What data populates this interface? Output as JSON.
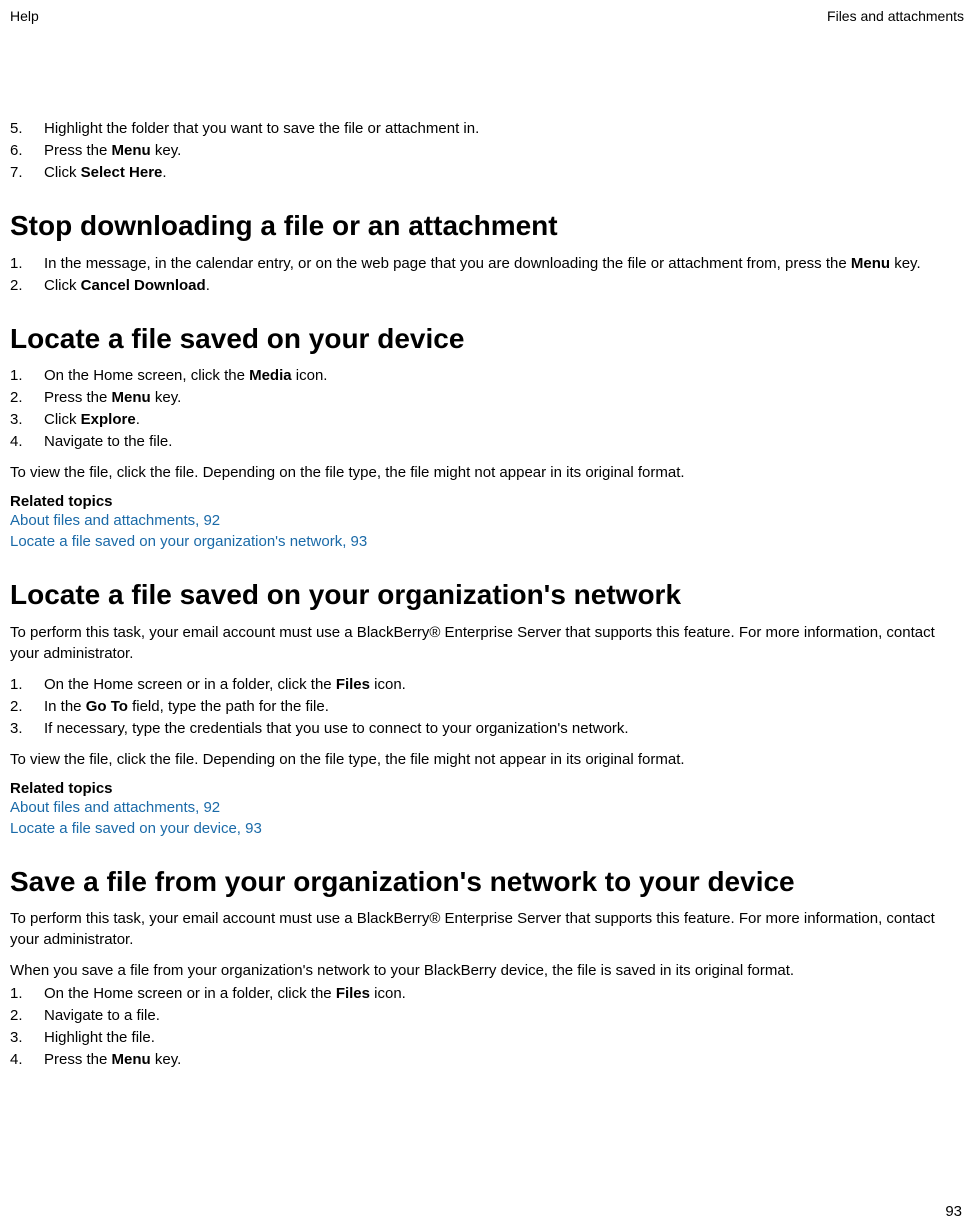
{
  "header": {
    "left": "Help",
    "right": "Files and attachments"
  },
  "list1": {
    "items": [
      {
        "num": "5.",
        "text": "Highlight the folder that you want to save the file or attachment in."
      },
      {
        "num": "6.",
        "prefix": "Press the ",
        "bold": "Menu",
        "suffix": " key."
      },
      {
        "num": "7.",
        "prefix": "Click ",
        "bold": "Select Here",
        "suffix": "."
      }
    ]
  },
  "h2_1": "Stop downloading a file or an attachment",
  "list2": {
    "items": [
      {
        "num": "1.",
        "prefix": "In the message, in the calendar entry, or on the web page that you are downloading the file or attachment from, press the ",
        "bold": "Menu",
        "suffix": " key."
      },
      {
        "num": "2.",
        "prefix": "Click ",
        "bold": "Cancel Download",
        "suffix": "."
      }
    ]
  },
  "h2_2": "Locate a file saved on your device",
  "list3": {
    "items": [
      {
        "num": "1.",
        "prefix": "On the Home screen, click the ",
        "bold": "Media",
        "suffix": " icon."
      },
      {
        "num": "2.",
        "prefix": "Press the ",
        "bold": "Menu",
        "suffix": " key."
      },
      {
        "num": "3.",
        "prefix": "Click ",
        "bold": "Explore",
        "suffix": "."
      },
      {
        "num": "4.",
        "text": "Navigate to the file."
      }
    ]
  },
  "p_viewfile": "To view the file, click the file. Depending on the file type, the file might not appear in its original format.",
  "related_heading": "Related topics",
  "related1": {
    "links": [
      "About files and attachments, 92",
      "Locate a file saved on your organization's network, 93"
    ]
  },
  "h2_3": "Locate a file saved on your organization's network",
  "p_prereq": "To perform this task, your email account must use a BlackBerry® Enterprise Server that supports this feature. For more information, contact your administrator.",
  "list4": {
    "items": [
      {
        "num": "1.",
        "prefix": "On the Home screen or in a folder, click the ",
        "bold": "Files",
        "suffix": " icon."
      },
      {
        "num": "2.",
        "prefix": "In the ",
        "bold": "Go To",
        "suffix": " field, type the path for the file."
      },
      {
        "num": "3.",
        "text": "If necessary, type the credentials that you use to connect to your organization's network."
      }
    ]
  },
  "related2": {
    "links": [
      "About files and attachments, 92",
      "Locate a file saved on your device, 93"
    ]
  },
  "h2_4": "Save a file from your organization's network to your device",
  "p_savenote": "When you save a file from your organization's network to your BlackBerry device, the file is saved in its original format.",
  "list5": {
    "items": [
      {
        "num": "1.",
        "prefix": "On the Home screen or in a folder, click the ",
        "bold": "Files",
        "suffix": " icon."
      },
      {
        "num": "2.",
        "text": "Navigate to a file."
      },
      {
        "num": "3.",
        "text": "Highlight the file."
      },
      {
        "num": "4.",
        "prefix": "Press the ",
        "bold": "Menu",
        "suffix": " key."
      }
    ]
  },
  "page_number": "93"
}
